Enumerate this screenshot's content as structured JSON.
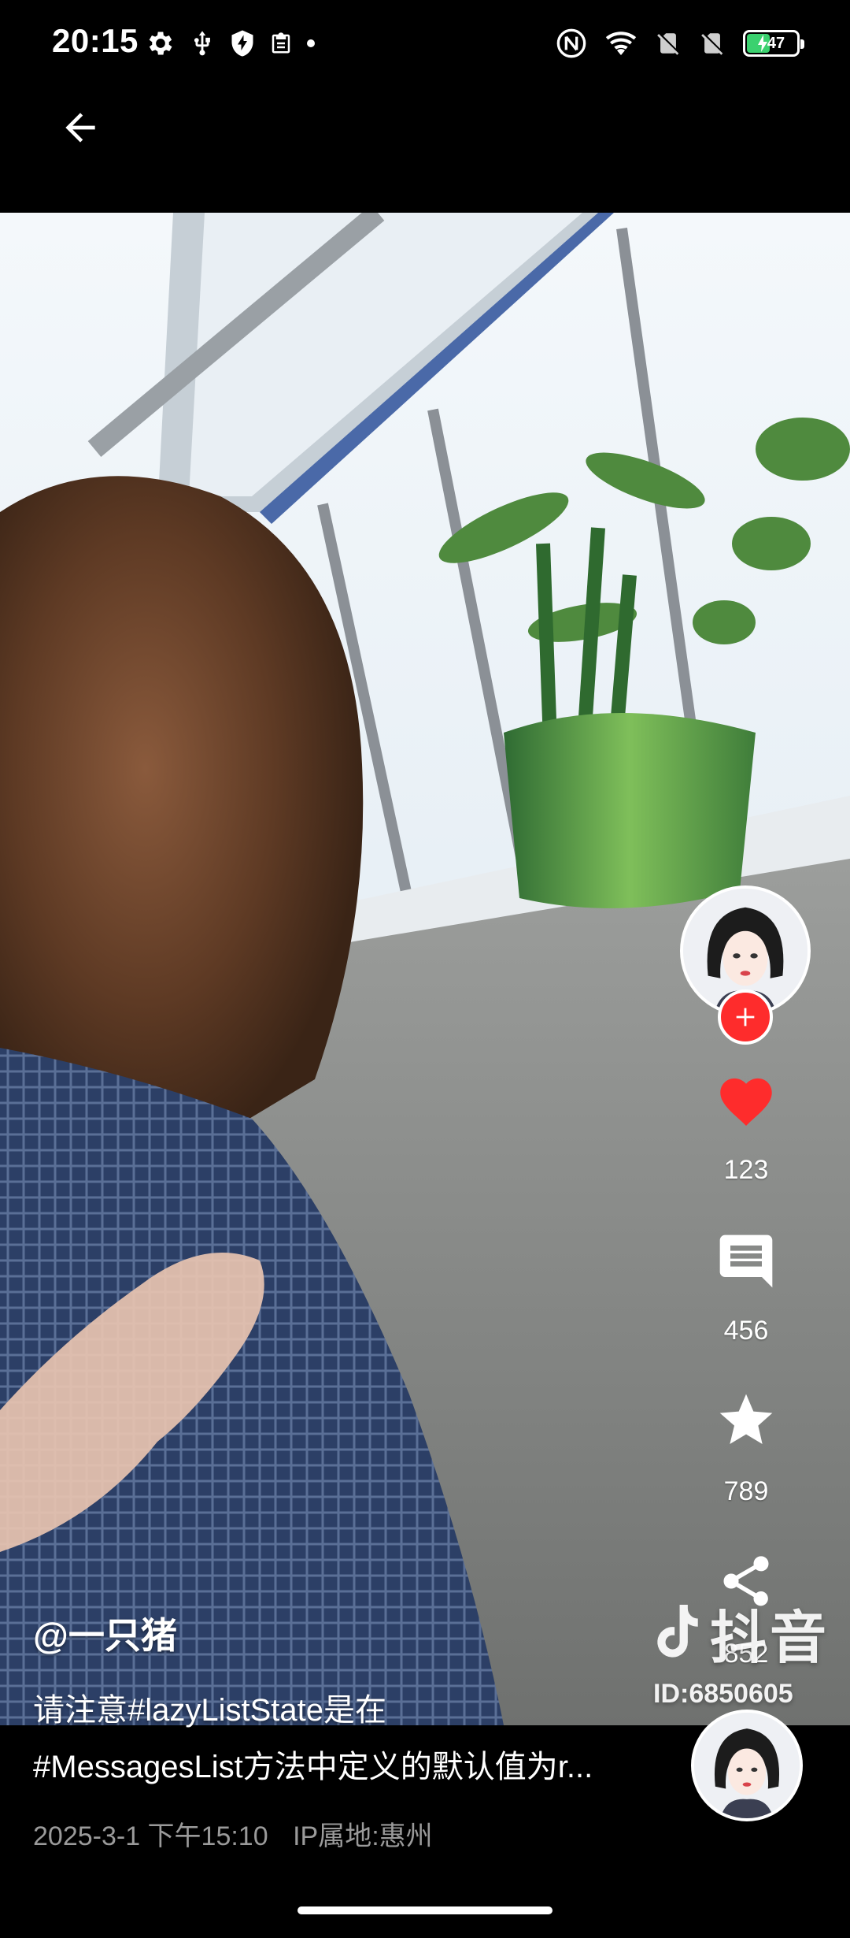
{
  "status_bar": {
    "time": "20:15",
    "battery_level": "47",
    "battery_fill_percent": 47,
    "left_icons": [
      "gear-icon",
      "usb-icon",
      "shield-icon",
      "clipboard-icon",
      "dot-icon"
    ],
    "right_icons": [
      "nfc-icon",
      "wifi-icon",
      "no-sim-icon",
      "no-sim-icon",
      "battery-charging-icon"
    ]
  },
  "top_bar": {
    "back_icon": "arrow-left-icon"
  },
  "video": {
    "author_avatar": "avatar-illustration"
  },
  "actions": {
    "like_count": "123",
    "comment_count": "456",
    "favorite_count": "789",
    "share_count": "852"
  },
  "watermark": {
    "brand": "抖音",
    "id_text": "ID:6850605"
  },
  "post": {
    "author": "@一只猪",
    "description_line1": "请注意#lazyListState是在",
    "description_line2": "#MessagesList方法中定义的默认值为r...",
    "date": "2025-3-1 下午15:10",
    "ip_location": "IP属地:惠州"
  },
  "colors": {
    "like_red": "#fe2c2c",
    "follow_red": "#fe2c2c",
    "meta_gray": "#9a9a9a",
    "battery_green": "#3bd16f"
  }
}
